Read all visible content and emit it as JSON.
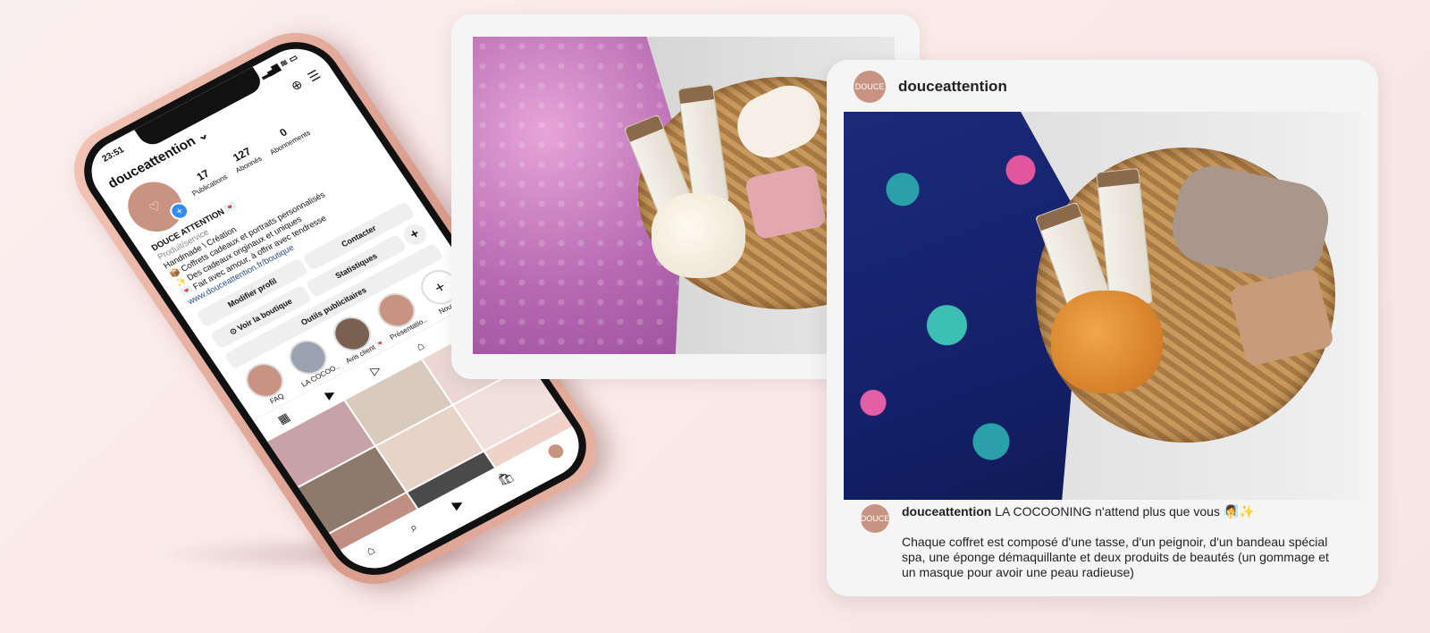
{
  "phone": {
    "status": {
      "time": "23:51",
      "icons": "▂▄▆ ≋ ▭"
    },
    "header": {
      "username": "douceattention",
      "chevron": "⌄",
      "add_icon": "⊕",
      "menu_icon": "☰"
    },
    "stats": [
      {
        "value": "17",
        "label": "Publications"
      },
      {
        "value": "127",
        "label": "Abonnés"
      },
      {
        "value": "0",
        "label": "Abonnements"
      }
    ],
    "bio": {
      "name": "DOUCE ATTENTION 💌",
      "category": "Produit/service",
      "line1": "Handmade \\ Création",
      "line2": "📦 Coffrets cadeaux et portraits personnalisés",
      "line3": "✨ Des cadeaux originaux et uniques",
      "line4": "💌 Fait avec amour, à offrir avec tendresse",
      "link": "www.douceattention.fr/boutique"
    },
    "buttons_row1": {
      "edit": "Modifier profil",
      "contact": "Contacter"
    },
    "buttons_row2": {
      "shop": "⊙ Voir la boutique",
      "stats": "Statistiques",
      "add": "+"
    },
    "buttons_row3": {
      "tools": "Outils publicitaires"
    },
    "highlights": [
      {
        "label": "FAQ",
        "color": "#c99381"
      },
      {
        "label": "LA COCOO...",
        "color": "#9aa4b0"
      },
      {
        "label": "Avis client 💌",
        "color": "#7a6050"
      },
      {
        "label": "Présentatio...",
        "color": "#c99381"
      },
      {
        "label": "Nouveau",
        "color": "#ffffff"
      }
    ],
    "tabs": [
      "▦",
      "▶",
      "▷",
      "⌂",
      "👤"
    ],
    "grid_colors": [
      "#c7a2a6",
      "#d8cbbd",
      "#ead7d4",
      "#8d7a6a",
      "#e8d3c8",
      "#f1e0dc",
      "#c28e83",
      "#4a4a4a",
      "#efd3cb"
    ],
    "bottom_nav": [
      "⌂",
      "⌕",
      "▶",
      "🛍"
    ]
  },
  "right_card": {
    "username": "douceattention",
    "avatar_text": "DOUCE",
    "caption_user": "douceattention",
    "caption_first": " LA COCOONING n'attend plus que vous 🧖‍♀️✨",
    "caption_body": "Chaque coffret est composé d'une tasse, d'un peignoir, d'un bandeau spécial spa, une éponge démaquillante et deux produits de beautés (un gommage et un masque pour avoir une peau radieuse)"
  }
}
